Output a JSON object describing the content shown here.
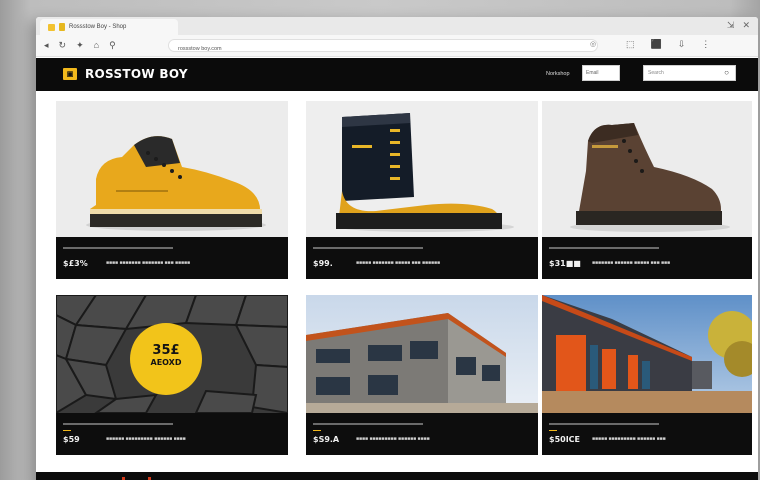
{
  "browser": {
    "tab_title": "Rossstow Boy - Shop",
    "address_text": "rossstow boy.com",
    "address_end": "◎",
    "window_controls": [
      "⇲",
      "✕"
    ],
    "nav_icons": [
      "◂",
      "↻",
      "✦",
      "⌂",
      "⚲"
    ],
    "toolbar_icons": [
      "⬚",
      "⬛",
      "⇩",
      "⋮"
    ]
  },
  "site": {
    "logo_mark": "▣",
    "name": "ROSSTOW BOY",
    "nav_link": "Norkshop",
    "input_placeholder": "Email",
    "search_placeholder": "Search",
    "search_icon": "○"
  },
  "colors": {
    "brand_yellow": "#f2b91c",
    "header_black": "#0b0b0b",
    "caption_black": "#0d0d0d"
  },
  "cards": [
    {
      "id": "work-boot-yellow",
      "price": "$£3%",
      "desc": "■■■■ ■■■■■■■ ■■■■■■■ ■■■ ■■■■■"
    },
    {
      "id": "work-boot-black-yellow",
      "price": "$99.",
      "desc": "■■■■■ ■■■■■■■ ■■■■■ ■■■ ■■■■■■"
    },
    {
      "id": "work-boot-brown",
      "price": "$31■■",
      "desc": "■■■■■■■ ■■■■■■ ■■■■■ ■■■ ■■■"
    },
    {
      "id": "sale-tiles",
      "price": "$59",
      "desc": "■■■■■■ ■■■■■■■■■ ■■■■■■ ■■■■"
    },
    {
      "id": "warehouse-grey",
      "price": "$S9.A",
      "desc": "■■■■ ■■■■■■■■■ ■■■■■■ ■■■■"
    },
    {
      "id": "warehouse-orange",
      "price": "$50ICE",
      "desc": "■■■■■ ■■■■■■■■■ ■■■■■■ ■■■"
    }
  ],
  "sale_badge": {
    "line1": "35£",
    "line2": "AEOXD"
  }
}
